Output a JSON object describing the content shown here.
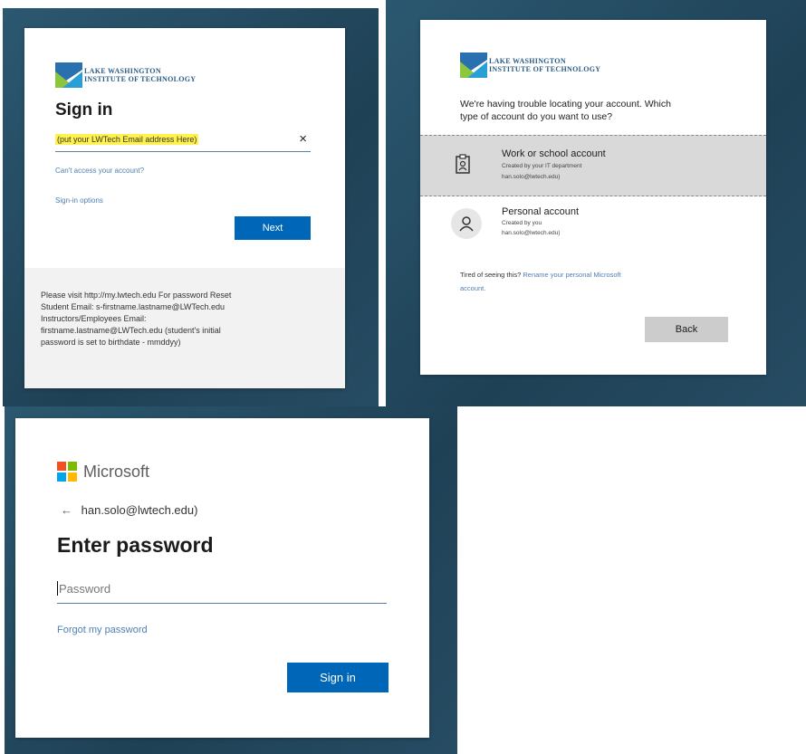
{
  "panel1": {
    "logo_line1": "LAKE WASHINGTON",
    "logo_line2": "INSTITUTE OF TECHNOLOGY",
    "title": "Sign in",
    "email_placeholder": "(put your LWTech Email address Here)",
    "clear_glyph": "×",
    "cant_access_link": "Can't access your account?",
    "signin_options_link": "Sign-in options",
    "next_button": "Next",
    "footer_lines": [
      "Please visit http://my.lwtech.edu For password Reset",
      "Student Email: s-firstname.lastname@LWTech.edu",
      "Instructors/Employees Email:",
      "firstname.lastname@LWTech.edu (student's initial",
      "password is set to birthdate - mmddyy)"
    ]
  },
  "panel2": {
    "logo_line1": "LAKE WASHINGTON",
    "logo_line2": "INSTITUTE OF TECHNOLOGY",
    "prompt_line1": "We're having trouble locating your account. Which",
    "prompt_line2": "type of account do you want to use?",
    "work_account": {
      "name": "Work or school account",
      "sub": "Created by your IT department",
      "email": "han.solo@lwtech.edu)"
    },
    "personal_account": {
      "name": "Personal account",
      "sub": "Created by you",
      "email": "han.solo@lwtech.edu)"
    },
    "tired_text": "Tired of seeing this?",
    "rename_link_line1": "Rename your personal Microsoft",
    "rename_link_line2": "account.",
    "back_button": "Back"
  },
  "panel3": {
    "brand": "Microsoft",
    "back_arrow": "←",
    "identity": "han.solo@lwtech.edu)",
    "title": "Enter password",
    "password_placeholder": "Password",
    "forgot_link": "Forgot my password",
    "signin_button": "Sign in"
  },
  "colors": {
    "background_panel": "#24495f",
    "primary_button": "#0067b8",
    "highlight": "#fff24d",
    "link": "#4f7fb4"
  }
}
